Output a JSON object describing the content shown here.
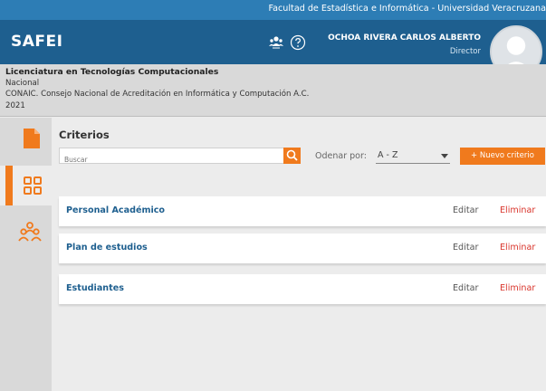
{
  "topbar": {
    "faculty_text": "Facultad de Estadística e Informática - Universidad Veracruzana"
  },
  "header": {
    "brand": "SAFEI",
    "user_name": "OCHOA RIVERA CARLOS ALBERTO",
    "user_role": "Director",
    "icons": [
      "users-icon",
      "help-icon",
      "avatar"
    ]
  },
  "program_info": {
    "title": "Licenciatura en Tecnologías Computacionales",
    "scope": "Nacional",
    "organization": "CONAIC. Consejo Nacional de Acreditación en Informática y Computación A.C.",
    "year": "2021"
  },
  "sidebar": {
    "items": [
      {
        "icon": "document-icon",
        "active": false
      },
      {
        "icon": "grid-icon",
        "active": true
      },
      {
        "icon": "people-icon",
        "active": false
      }
    ]
  },
  "main": {
    "title": "Criterios",
    "search_placeholder": "Buscar",
    "sort_label": "Odenar por:",
    "sort_value": "A - Z",
    "new_button": "+ Nuevo criterio",
    "rows": [
      {
        "name": "Personal Académico",
        "edit": "Editar",
        "delete": "Eliminar"
      },
      {
        "name": "Plan de estudios",
        "edit": "Editar",
        "delete": "Eliminar"
      },
      {
        "name": "Estudiantes",
        "edit": "Editar",
        "delete": "Eliminar"
      }
    ]
  },
  "colors": {
    "accent": "#f07a1d",
    "header": "#1e5f8f",
    "topstrip": "#2d7db5",
    "link": "#1e5f8f",
    "danger": "#d9342b"
  }
}
